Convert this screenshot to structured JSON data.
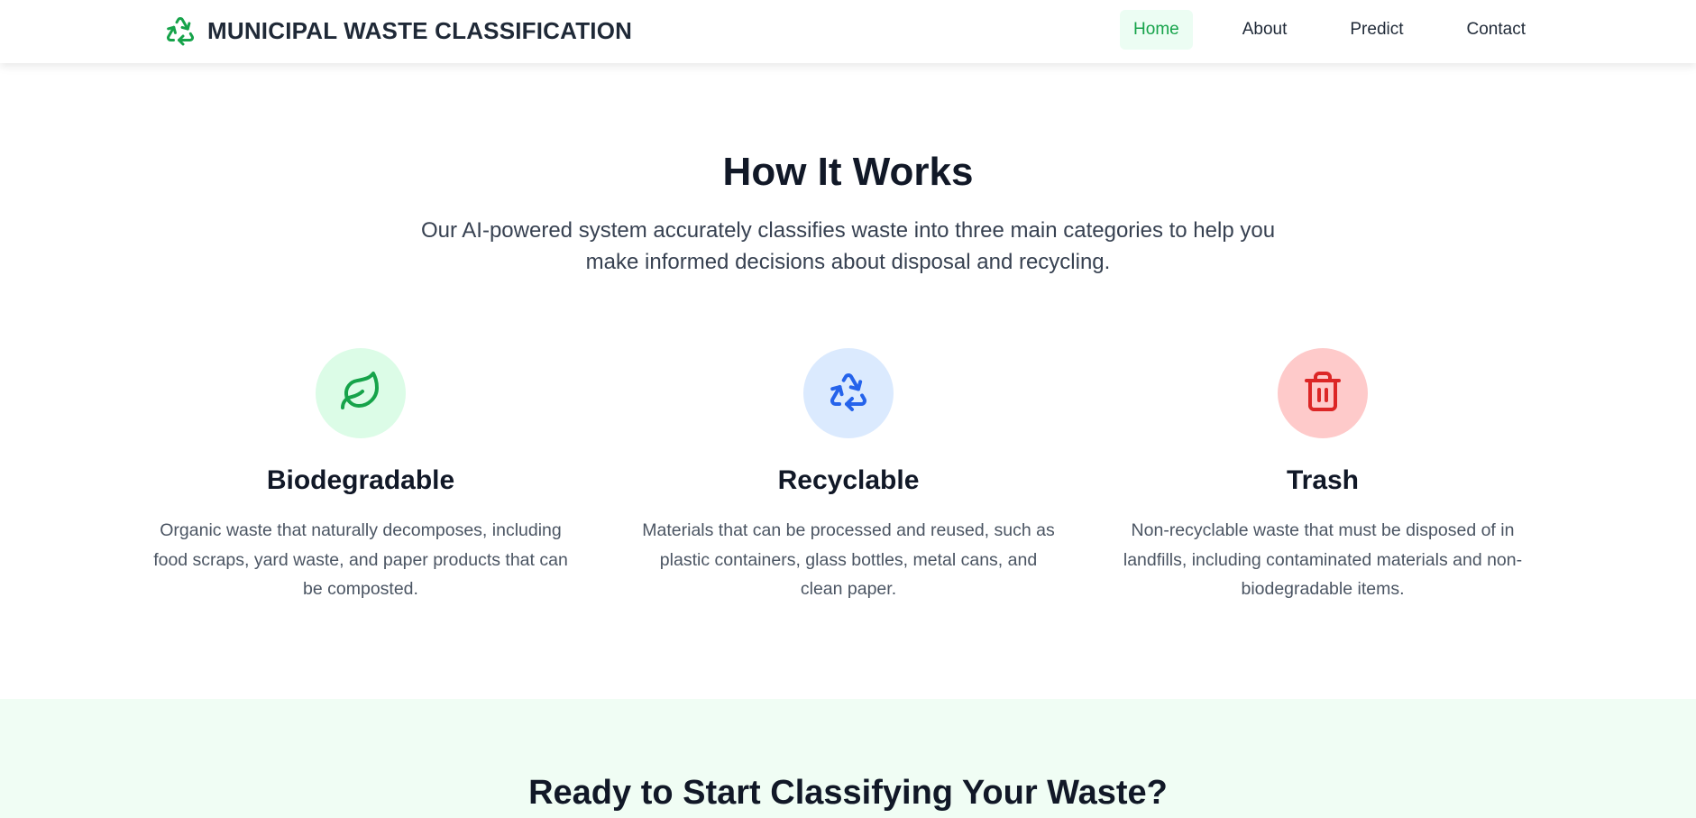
{
  "header": {
    "brand_title": "MUNICIPAL WASTE CLASSIFICATION",
    "brand_icon": "recycle-icon",
    "nav": [
      {
        "label": "Home",
        "active": true
      },
      {
        "label": "About",
        "active": false
      },
      {
        "label": "Predict",
        "active": false
      },
      {
        "label": "Contact",
        "active": false
      }
    ]
  },
  "how_it_works": {
    "title": "How It Works",
    "subtitle": "Our AI-powered system accurately classifies waste into three main categories to help you make informed decisions about disposal and recycling.",
    "cards": [
      {
        "icon": "leaf-icon",
        "title": "Biodegradable",
        "description": "Organic waste that naturally decomposes, including food scraps, yard waste, and paper products that can be composted.",
        "accent": "#16a34a",
        "bg": "#dcfce7"
      },
      {
        "icon": "recycle-icon",
        "title": "Recyclable",
        "description": "Materials that can be processed and reused, such as plastic containers, glass bottles, metal cans, and clean paper.",
        "accent": "#2563eb",
        "bg": "#dbeafe"
      },
      {
        "icon": "trash-icon",
        "title": "Trash",
        "description": "Non-recyclable waste that must be disposed of in landfills, including contaminated materials and non-biodegradable items.",
        "accent": "#dc2626",
        "bg": "#fecaca"
      }
    ]
  },
  "cta": {
    "title": "Ready to Start Classifying Your Waste?"
  },
  "colors": {
    "brand_green": "#16a34a",
    "nav_active_bg": "#ecfdf3",
    "cta_bg": "#f0fdf4"
  }
}
